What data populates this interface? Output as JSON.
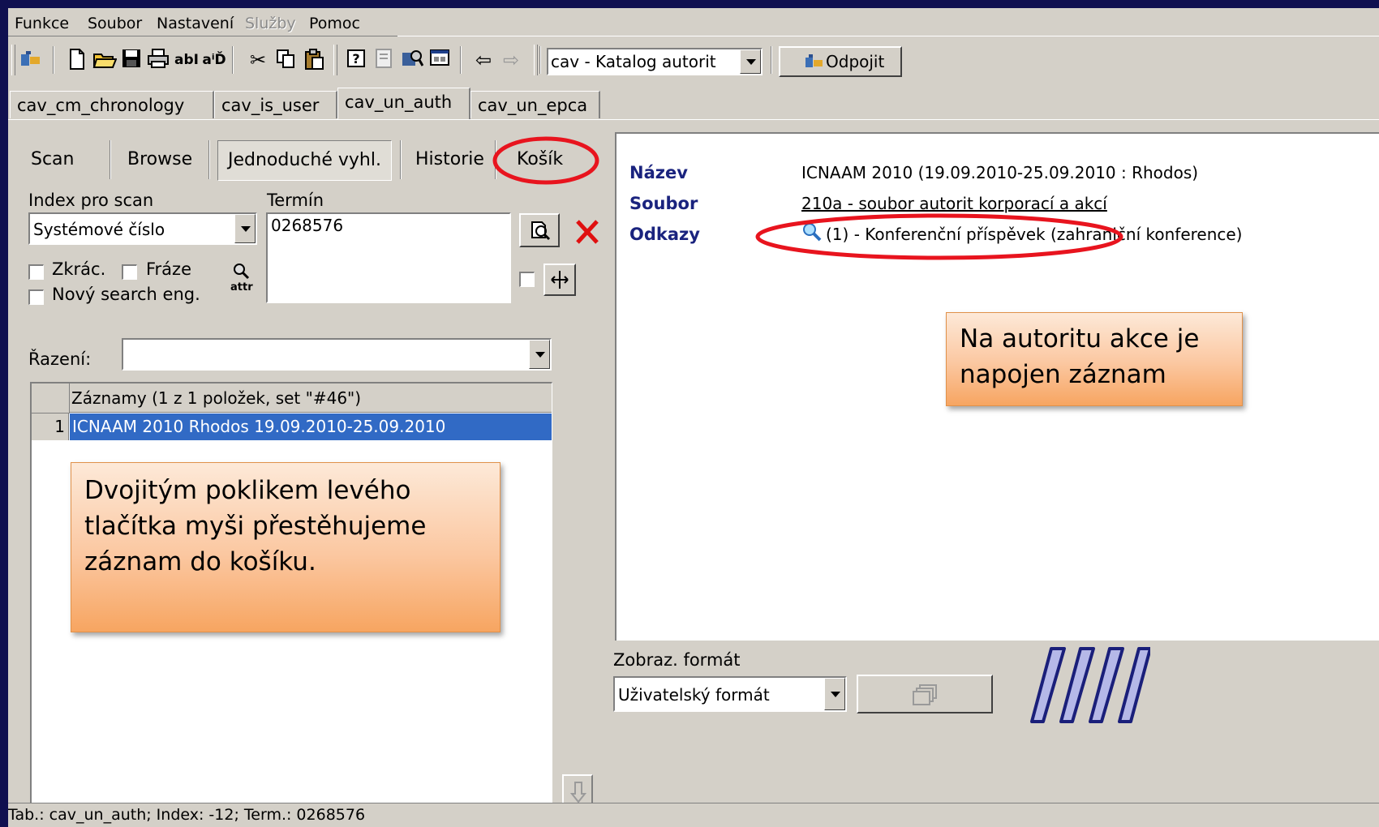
{
  "menu": {
    "items": [
      {
        "label": "Funkce",
        "disabled": false
      },
      {
        "label": "Soubor",
        "disabled": false
      },
      {
        "label": "Nastavení",
        "disabled": false
      },
      {
        "label": "Služby",
        "disabled": true
      },
      {
        "label": "Pomoc",
        "disabled": false
      }
    ]
  },
  "toolbar": {
    "database_selected": "cav - Katalog autorit",
    "disconnect_label": "Odpojit"
  },
  "tabs": [
    {
      "label": "cav_cm_chronology",
      "active": false
    },
    {
      "label": "cav_is_user",
      "active": false
    },
    {
      "label": "cav_un_auth",
      "active": true
    },
    {
      "label": "cav_un_epca",
      "active": false
    }
  ],
  "search": {
    "subtabs": [
      "Scan",
      "Browse",
      "Jednoduché vyhl.",
      "Historie",
      "Košík"
    ],
    "index_label": "Index pro scan",
    "term_label": "Termín",
    "index_value": "Systémové číslo",
    "term_value": "0268576",
    "chk_zkrac": "Zkrác.",
    "chk_fraze": "Fráze",
    "chk_novy": "Nový search eng.",
    "attr_label": "attr",
    "sort_label": "Řazení:",
    "sort_value": ""
  },
  "results": {
    "header": "Záznamy (1 z 1 položek, set \"#46\")",
    "rows": [
      {
        "num": "1",
        "text": "ICNAAM 2010 Rhodos 19.09.2010-25.09.2010"
      }
    ]
  },
  "record": {
    "fields": [
      {
        "label": "Název",
        "value": "ICNAAM 2010 (19.09.2010-25.09.2010 : Rhodos)"
      },
      {
        "label": "Soubor",
        "value": "210a - soubor autorit korporací a akcí"
      },
      {
        "label": "Odkazy",
        "value": "(1) - Konferenční příspěvek (zahraniční konference)"
      }
    ]
  },
  "display_format": {
    "label": "Zobraz. formát",
    "value": "Uživatelský formát"
  },
  "callouts": {
    "right": "Na autoritu akce je napojen záznam",
    "left": "Dvojitým poklikem levého tlačítka myši přestěhujeme záznam do košíku."
  },
  "status": "Tab.: cav_un_auth; Index: -12; Term.: 0268576",
  "colors": {
    "selection": "#316ac5",
    "highlight_ring": "#e8141e",
    "field_label": "#1a237e",
    "callout": "#f9b98a"
  }
}
